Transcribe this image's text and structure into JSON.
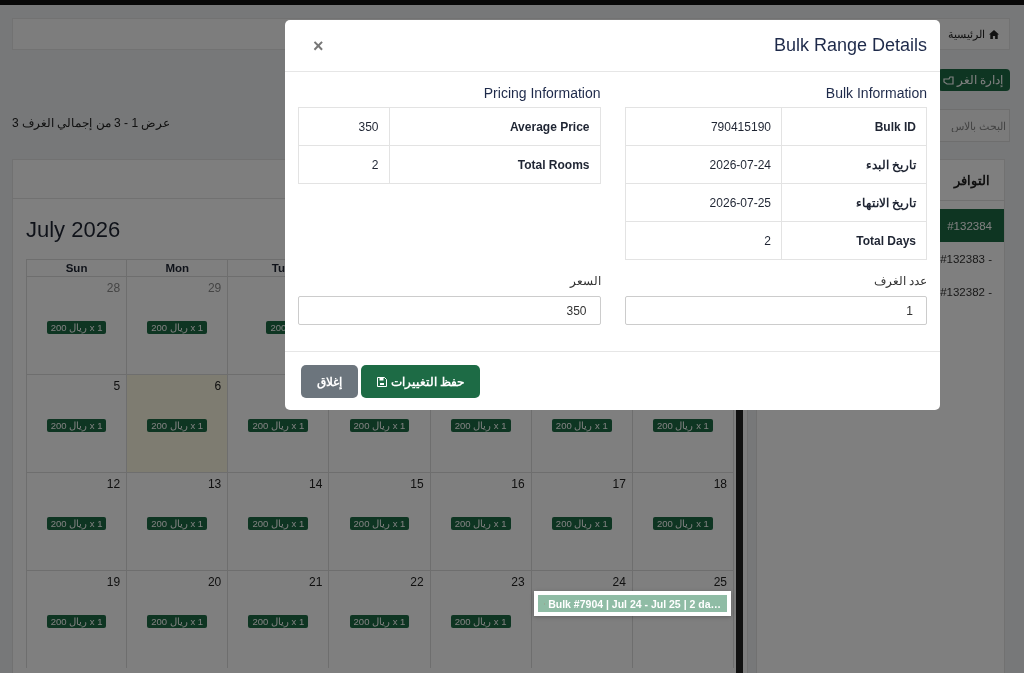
{
  "breadcrumb": {
    "home": "الرئيسية"
  },
  "toolbar": {
    "manage_button": "إدارة الغر",
    "search": {
      "placeholder": "البحث بالاس"
    },
    "summary": "عرض 1 - 3 من إجمالي الغرف 3"
  },
  "calendar": {
    "title": "July 2026",
    "weekdays": {
      "sun": "Sun",
      "mon": "Mon",
      "tue": "Tu"
    },
    "weeks": [
      {
        "cells": {
          "sun": {
            "day": "28",
            "muted": true,
            "today": false,
            "badge": "1 x ريال 200"
          },
          "mon": {
            "day": "29",
            "muted": true,
            "today": false,
            "badge": "1 x ريال 200"
          },
          "tue": {
            "today": false,
            "badge": "200"
          }
        }
      },
      {
        "cells": {
          "sun": {
            "day": "5",
            "muted": false,
            "today": false,
            "badge": "1 x ريال 200"
          },
          "mon": {
            "day": "6",
            "muted": false,
            "today": true,
            "badge": "1 x ريال 200"
          },
          "tue": {
            "today": false,
            "badge": "1 x ريال 200"
          },
          "wed": {
            "today": false,
            "badge": "1 x ريال 200"
          },
          "thu": {
            "today": false,
            "badge": "1 x ريال 200"
          },
          "fri": {
            "today": false,
            "badge": "1 x ريال 200"
          },
          "sat": {
            "today": false,
            "badge": "1 x ريال 200"
          }
        }
      },
      {
        "cells": {
          "sun": {
            "day": "12",
            "muted": false,
            "today": false,
            "badge": "1 x ريال 200"
          },
          "mon": {
            "day": "13",
            "muted": false,
            "today": false,
            "badge": "1 x ريال 200"
          },
          "tue": {
            "day": "14",
            "muted": false,
            "today": false,
            "badge": "1 x ريال 200"
          },
          "wed": {
            "day": "15",
            "muted": false,
            "today": false,
            "badge": "1 x ريال 200"
          },
          "thu": {
            "day": "16",
            "muted": false,
            "today": false,
            "badge": "1 x ريال 200"
          },
          "fri": {
            "day": "17",
            "muted": false,
            "today": false,
            "badge": "1 x ريال 200"
          },
          "sat": {
            "day": "18",
            "muted": false,
            "today": false,
            "badge": "1 x ريال 200"
          }
        }
      },
      {
        "cells": {
          "sun": {
            "day": "19",
            "muted": false,
            "today": false,
            "badge": "1 x ريال 200"
          },
          "mon": {
            "day": "20",
            "muted": false,
            "today": false,
            "badge": "1 x ريال 200"
          },
          "tue": {
            "day": "21",
            "muted": false,
            "today": false,
            "badge": "1 x ريال 200"
          },
          "wed": {
            "day": "22",
            "muted": false,
            "today": false,
            "badge": "1 x ريال 200"
          },
          "thu": {
            "day": "23",
            "muted": false,
            "today": false,
            "badge": "1 x ريال 200"
          },
          "fri": {
            "day": "24",
            "muted": false,
            "today": false,
            "event": "Bulk #7904 | Jul 24 - Jul 25 | 2 da…"
          },
          "sat": {
            "day": "25",
            "muted": false,
            "today": false,
            "event_continued": true
          }
        }
      }
    ]
  },
  "rooms": {
    "header": "التوافر",
    "items": [
      {
        "label": "#132384",
        "selected": true
      },
      {
        "label": "- #132383",
        "selected": false
      },
      {
        "label": "- #132382",
        "selected": false
      }
    ]
  },
  "modal": {
    "title": "Bulk Range Details",
    "close": "×",
    "sections": [
      {
        "heading": "Bulk Information",
        "rows": [
          {
            "label": "Bulk ID",
            "value": "790415190"
          },
          {
            "label": "تاريخ البدء",
            "value": "2026-07-24"
          },
          {
            "label": "تاريخ الانتهاء",
            "value": "2026-07-25"
          },
          {
            "label": "Total Days",
            "value": "2"
          }
        ]
      },
      {
        "heading": "Pricing Information",
        "rows": [
          {
            "label": "Average Price",
            "value": "350"
          },
          {
            "label": "Total Rooms",
            "value": "2"
          }
        ]
      }
    ],
    "fields": [
      {
        "label": "عدد الغرف",
        "value": "1"
      },
      {
        "label": "السعر",
        "value": "350"
      }
    ],
    "buttons": [
      {
        "label": "حفظ التغييرات",
        "kind": "primary"
      },
      {
        "label": "إغلاق",
        "kind": "secondary"
      }
    ]
  }
}
